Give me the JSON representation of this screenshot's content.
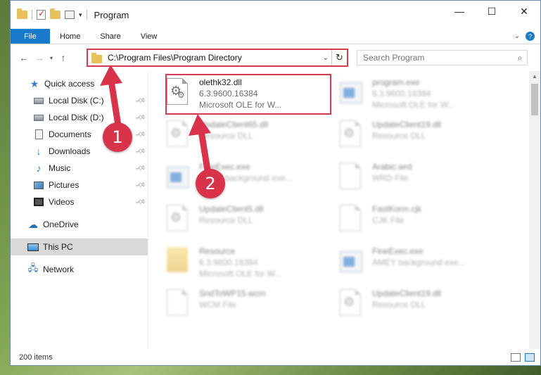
{
  "window": {
    "title": "Program",
    "controls": {
      "minimize": "—",
      "maximize": "☐",
      "close": "✕"
    }
  },
  "ribbon": {
    "tabs": [
      {
        "label": "File"
      },
      {
        "label": "Home"
      },
      {
        "label": "Share"
      },
      {
        "label": "View"
      }
    ],
    "help": "?"
  },
  "address": {
    "path": "C:\\Program Files\\Program Directory"
  },
  "search": {
    "placeholder": "Search Program"
  },
  "sidebar": {
    "items": [
      {
        "label": "Quick access",
        "icon": "star-icon",
        "pinned": false
      },
      {
        "label": "Local Disk (C:)",
        "icon": "disk-icon",
        "pinned": true
      },
      {
        "label": "Local Disk (D:)",
        "icon": "disk-icon",
        "pinned": true
      },
      {
        "label": "Documents",
        "icon": "document-icon",
        "pinned": true
      },
      {
        "label": "Downloads",
        "icon": "download-icon",
        "pinned": true
      },
      {
        "label": "Music",
        "icon": "music-icon",
        "pinned": true
      },
      {
        "label": "Pictures",
        "icon": "pictures-icon",
        "pinned": true
      },
      {
        "label": "Videos",
        "icon": "video-icon",
        "pinned": true
      },
      {
        "label": "OneDrive",
        "icon": "cloud-icon",
        "pinned": false
      },
      {
        "label": "This PC",
        "icon": "computer-icon",
        "pinned": false,
        "selected": true
      },
      {
        "label": "Network",
        "icon": "network-icon",
        "pinned": false
      }
    ]
  },
  "files": [
    {
      "name": "olethk32.dll",
      "line2": "6.3.9600.16384",
      "line3": "Microsoft OLE for W...",
      "icon": "dll-gear-icon",
      "highlighted": true
    },
    {
      "name": "program.exe",
      "line2": "6.3.9600.16384",
      "line3": "Microsoft OLE for W...",
      "icon": "exe-icon"
    },
    {
      "name": "UpdateClient65.dll",
      "line2": "Resource DLL",
      "icon": "dll-gear-icon"
    },
    {
      "name": "UpdateClient19.dll",
      "line2": "Resource DLL",
      "icon": "dll-gear-icon"
    },
    {
      "name": "FineExec.exe",
      "line2": "AMEY background exe...",
      "icon": "exe-icon"
    },
    {
      "name": "Arabic.wrd",
      "line2": "WRD File",
      "icon": "page-icon"
    },
    {
      "name": "UpdateClient5.dll",
      "line2": "Resource DLL",
      "icon": "dll-gear-icon"
    },
    {
      "name": "FastKorm.cjk",
      "line2": "CJK File",
      "icon": "page-icon"
    },
    {
      "name": "Resource",
      "line2": "6.3.9600.16384",
      "line3": "Microsoft OLE for W...",
      "icon": "folder-icon"
    },
    {
      "name": "FineExec.exe",
      "line2": "AMEY background exe...",
      "icon": "exe-icon"
    },
    {
      "name": "SndToWP15.wcm",
      "line2": "WCM File",
      "icon": "page-icon"
    },
    {
      "name": "UpdateClient19.dll",
      "line2": "Resource DLL",
      "icon": "dll-gear-icon"
    }
  ],
  "status": {
    "item_count": "200 items"
  },
  "callouts": [
    {
      "label": "1"
    },
    {
      "label": "2"
    }
  ],
  "colors": {
    "accent": "#1979ca",
    "highlight_red": "#d9394c",
    "callout_red": "#d8334a"
  }
}
